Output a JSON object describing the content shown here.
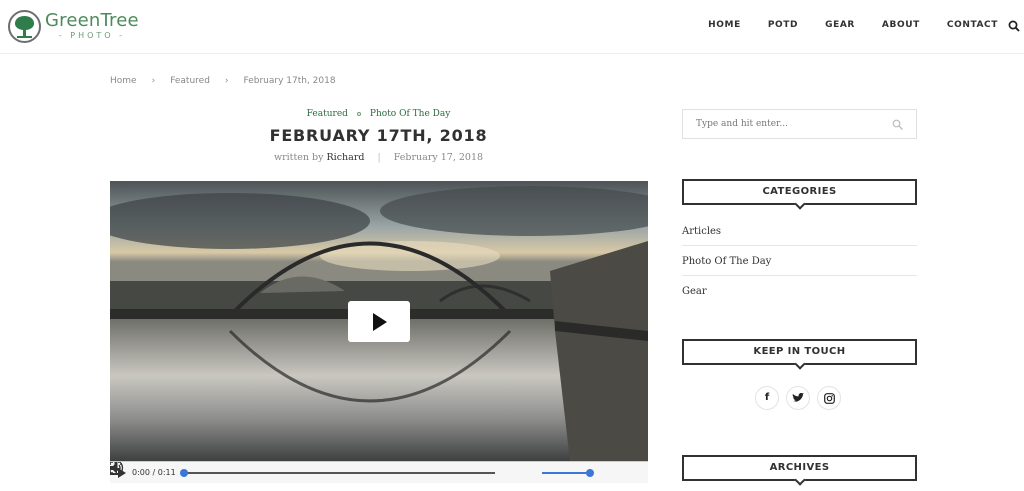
{
  "header": {
    "logo_main": "GreenTree",
    "logo_sub": "PHOTO",
    "nav": [
      "HOME",
      "POTD",
      "GEAR",
      "ABOUT",
      "CONTACT"
    ]
  },
  "breadcrumb": [
    "Home",
    "Featured",
    "February 17th, 2018"
  ],
  "post": {
    "categories": [
      "Featured",
      "Photo Of The Day"
    ],
    "title": "FEBRUARY 17TH, 2018",
    "written_by": "written by",
    "author": "Richard",
    "date": "February 17, 2018"
  },
  "video": {
    "time": "0:00 / 0:11",
    "progress": 0,
    "volume": 1
  },
  "sidebar": {
    "search_placeholder": "Type and hit enter...",
    "categories_title": "CATEGORIES",
    "categories": [
      "Articles",
      "Photo Of The Day",
      "Gear"
    ],
    "keep_in_touch_title": "KEEP IN TOUCH",
    "archives_title": "ARCHIVES"
  },
  "colors": {
    "brand_green": "#2b6b3e",
    "accent_blue": "#3a77d8",
    "text": "#313131"
  },
  "icons": [
    "search-icon",
    "play-icon",
    "volume-icon",
    "fullscreen-icon",
    "download-icon",
    "facebook-icon",
    "twitter-icon",
    "instagram-icon"
  ]
}
